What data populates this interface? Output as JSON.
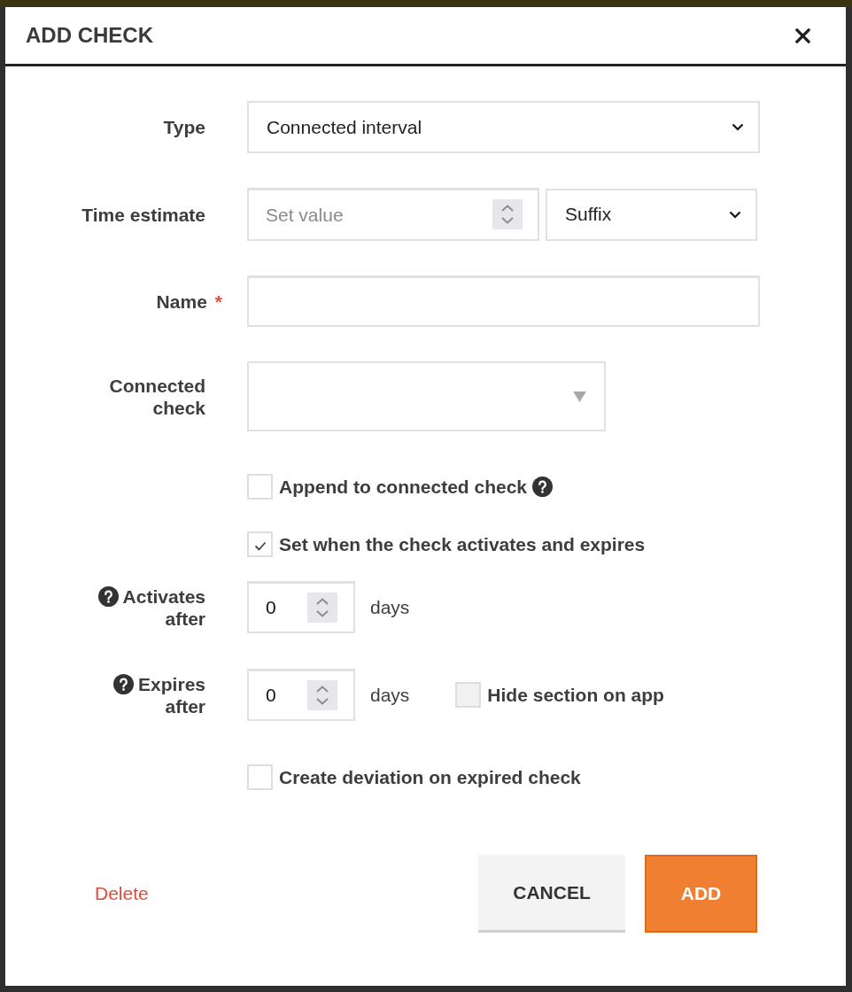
{
  "dialog": {
    "title": "ADD CHECK"
  },
  "fields": [
    {
      "kind": "select",
      "label": "Type",
      "value": "Connected interval"
    },
    {
      "kind": "number_suffix",
      "label": "Time estimate",
      "placeholder": "Set value",
      "suffix": "Suffix"
    },
    {
      "kind": "text",
      "label": "Name",
      "required_mark": "*"
    },
    {
      "kind": "combo",
      "label": "Connected check"
    },
    {
      "kind": "checkbox",
      "label": "Append to connected check",
      "checked": false,
      "disabled": false,
      "help": true
    },
    {
      "kind": "checkbox",
      "label": "Set when the check activates and expires",
      "checked": true,
      "disabled": false,
      "help": false
    },
    {
      "kind": "days",
      "label": "Activates after",
      "help": true,
      "value": "0",
      "unit": "days"
    },
    {
      "kind": "days",
      "label": "Expires after",
      "help": true,
      "value": "0",
      "unit": "days",
      "checkbox": {
        "label": "Hide section on app",
        "checked": false,
        "disabled": true
      }
    },
    {
      "kind": "checkbox",
      "label": "Create deviation on expired check",
      "checked": false,
      "disabled": false,
      "help": false
    }
  ],
  "footer": {
    "delete": "Delete",
    "buttons": [
      {
        "label": "CANCEL",
        "kind": "secondary"
      },
      {
        "label": "ADD",
        "kind": "primary"
      }
    ]
  }
}
